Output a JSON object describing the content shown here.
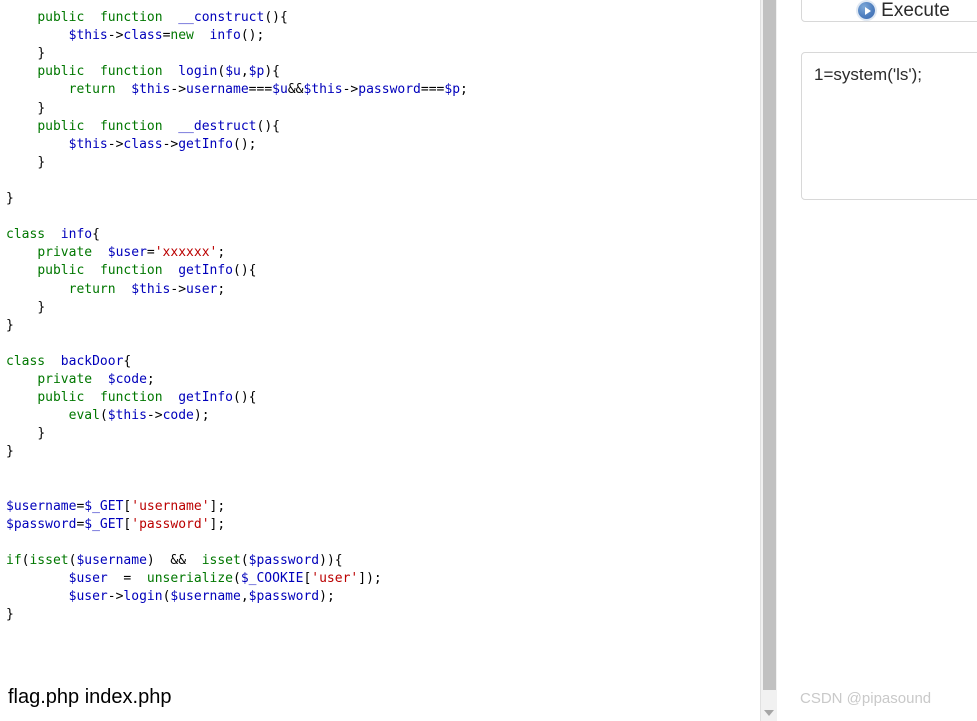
{
  "code_pane": {
    "language": "php",
    "lines": [
      {
        "indent": 0,
        "tokens": []
      },
      {
        "indent": 4,
        "tokens": [
          {
            "t": "public",
            "c": "kw"
          },
          {
            "t": "  ",
            "c": "pun"
          },
          {
            "t": "function",
            "c": "kw"
          },
          {
            "t": "  ",
            "c": "pun"
          },
          {
            "t": "__construct",
            "c": "var"
          },
          {
            "t": "(){",
            "c": "pun"
          }
        ]
      },
      {
        "indent": 8,
        "tokens": [
          {
            "t": "$this",
            "c": "var"
          },
          {
            "t": "->",
            "c": "pun"
          },
          {
            "t": "class",
            "c": "var"
          },
          {
            "t": "=",
            "c": "pun"
          },
          {
            "t": "new",
            "c": "kw"
          },
          {
            "t": "  ",
            "c": "pun"
          },
          {
            "t": "info",
            "c": "var"
          },
          {
            "t": "();",
            "c": "pun"
          }
        ]
      },
      {
        "indent": 4,
        "tokens": [
          {
            "t": "}",
            "c": "pun"
          }
        ]
      },
      {
        "indent": 4,
        "tokens": [
          {
            "t": "public",
            "c": "kw"
          },
          {
            "t": "  ",
            "c": "pun"
          },
          {
            "t": "function",
            "c": "kw"
          },
          {
            "t": "  ",
            "c": "pun"
          },
          {
            "t": "login",
            "c": "var"
          },
          {
            "t": "(",
            "c": "pun"
          },
          {
            "t": "$u",
            "c": "var"
          },
          {
            "t": ",",
            "c": "pun"
          },
          {
            "t": "$p",
            "c": "var"
          },
          {
            "t": "){",
            "c": "pun"
          }
        ]
      },
      {
        "indent": 8,
        "tokens": [
          {
            "t": "return",
            "c": "kw"
          },
          {
            "t": "  ",
            "c": "pun"
          },
          {
            "t": "$this",
            "c": "var"
          },
          {
            "t": "->",
            "c": "pun"
          },
          {
            "t": "username",
            "c": "var"
          },
          {
            "t": "===",
            "c": "pun"
          },
          {
            "t": "$u",
            "c": "var"
          },
          {
            "t": "&&",
            "c": "pun"
          },
          {
            "t": "$this",
            "c": "var"
          },
          {
            "t": "->",
            "c": "pun"
          },
          {
            "t": "password",
            "c": "var"
          },
          {
            "t": "===",
            "c": "pun"
          },
          {
            "t": "$p",
            "c": "var"
          },
          {
            "t": ";",
            "c": "pun"
          }
        ]
      },
      {
        "indent": 4,
        "tokens": [
          {
            "t": "}",
            "c": "pun"
          }
        ]
      },
      {
        "indent": 4,
        "tokens": [
          {
            "t": "public",
            "c": "kw"
          },
          {
            "t": "  ",
            "c": "pun"
          },
          {
            "t": "function",
            "c": "kw"
          },
          {
            "t": "  ",
            "c": "pun"
          },
          {
            "t": "__destruct",
            "c": "var"
          },
          {
            "t": "(){",
            "c": "pun"
          }
        ]
      },
      {
        "indent": 8,
        "tokens": [
          {
            "t": "$this",
            "c": "var"
          },
          {
            "t": "->",
            "c": "pun"
          },
          {
            "t": "class",
            "c": "var"
          },
          {
            "t": "->",
            "c": "pun"
          },
          {
            "t": "getInfo",
            "c": "var"
          },
          {
            "t": "();",
            "c": "pun"
          }
        ]
      },
      {
        "indent": 4,
        "tokens": [
          {
            "t": "}",
            "c": "pun"
          }
        ]
      },
      {
        "indent": 0,
        "tokens": []
      },
      {
        "indent": 0,
        "tokens": [
          {
            "t": "}",
            "c": "pun"
          }
        ]
      },
      {
        "indent": 0,
        "tokens": []
      },
      {
        "indent": 0,
        "tokens": [
          {
            "t": "class",
            "c": "kw"
          },
          {
            "t": "  ",
            "c": "pun"
          },
          {
            "t": "info",
            "c": "var"
          },
          {
            "t": "{",
            "c": "pun"
          }
        ]
      },
      {
        "indent": 4,
        "tokens": [
          {
            "t": "private",
            "c": "kw"
          },
          {
            "t": "  ",
            "c": "pun"
          },
          {
            "t": "$user",
            "c": "var"
          },
          {
            "t": "=",
            "c": "pun"
          },
          {
            "t": "'xxxxxx'",
            "c": "str"
          },
          {
            "t": ";",
            "c": "pun"
          }
        ]
      },
      {
        "indent": 4,
        "tokens": [
          {
            "t": "public",
            "c": "kw"
          },
          {
            "t": "  ",
            "c": "pun"
          },
          {
            "t": "function",
            "c": "kw"
          },
          {
            "t": "  ",
            "c": "pun"
          },
          {
            "t": "getInfo",
            "c": "var"
          },
          {
            "t": "(){",
            "c": "pun"
          }
        ]
      },
      {
        "indent": 8,
        "tokens": [
          {
            "t": "return",
            "c": "kw"
          },
          {
            "t": "  ",
            "c": "pun"
          },
          {
            "t": "$this",
            "c": "var"
          },
          {
            "t": "->",
            "c": "pun"
          },
          {
            "t": "user",
            "c": "var"
          },
          {
            "t": ";",
            "c": "pun"
          }
        ]
      },
      {
        "indent": 4,
        "tokens": [
          {
            "t": "}",
            "c": "pun"
          }
        ]
      },
      {
        "indent": 0,
        "tokens": [
          {
            "t": "}",
            "c": "pun"
          }
        ]
      },
      {
        "indent": 0,
        "tokens": []
      },
      {
        "indent": 0,
        "tokens": [
          {
            "t": "class",
            "c": "kw"
          },
          {
            "t": "  ",
            "c": "pun"
          },
          {
            "t": "backDoor",
            "c": "var"
          },
          {
            "t": "{",
            "c": "pun"
          }
        ]
      },
      {
        "indent": 4,
        "tokens": [
          {
            "t": "private",
            "c": "kw"
          },
          {
            "t": "  ",
            "c": "pun"
          },
          {
            "t": "$code",
            "c": "var"
          },
          {
            "t": ";",
            "c": "pun"
          }
        ]
      },
      {
        "indent": 4,
        "tokens": [
          {
            "t": "public",
            "c": "kw"
          },
          {
            "t": "  ",
            "c": "pun"
          },
          {
            "t": "function",
            "c": "kw"
          },
          {
            "t": "  ",
            "c": "pun"
          },
          {
            "t": "getInfo",
            "c": "var"
          },
          {
            "t": "(){",
            "c": "pun"
          }
        ]
      },
      {
        "indent": 8,
        "tokens": [
          {
            "t": "eval",
            "c": "kw"
          },
          {
            "t": "(",
            "c": "pun"
          },
          {
            "t": "$this",
            "c": "var"
          },
          {
            "t": "->",
            "c": "pun"
          },
          {
            "t": "code",
            "c": "var"
          },
          {
            "t": ");",
            "c": "pun"
          }
        ]
      },
      {
        "indent": 4,
        "tokens": [
          {
            "t": "}",
            "c": "pun"
          }
        ]
      },
      {
        "indent": 0,
        "tokens": [
          {
            "t": "}",
            "c": "pun"
          }
        ]
      },
      {
        "indent": 0,
        "tokens": []
      },
      {
        "indent": 0,
        "tokens": []
      },
      {
        "indent": 0,
        "tokens": [
          {
            "t": "$username",
            "c": "var"
          },
          {
            "t": "=",
            "c": "pun"
          },
          {
            "t": "$_GET",
            "c": "var"
          },
          {
            "t": "[",
            "c": "pun"
          },
          {
            "t": "'username'",
            "c": "str"
          },
          {
            "t": "];",
            "c": "pun"
          }
        ]
      },
      {
        "indent": 0,
        "tokens": [
          {
            "t": "$password",
            "c": "var"
          },
          {
            "t": "=",
            "c": "pun"
          },
          {
            "t": "$_GET",
            "c": "var"
          },
          {
            "t": "[",
            "c": "pun"
          },
          {
            "t": "'password'",
            "c": "str"
          },
          {
            "t": "];",
            "c": "pun"
          }
        ]
      },
      {
        "indent": 0,
        "tokens": []
      },
      {
        "indent": 0,
        "tokens": [
          {
            "t": "if",
            "c": "kw"
          },
          {
            "t": "(",
            "c": "pun"
          },
          {
            "t": "isset",
            "c": "kw"
          },
          {
            "t": "(",
            "c": "pun"
          },
          {
            "t": "$username",
            "c": "var"
          },
          {
            "t": ")",
            "c": "pun"
          },
          {
            "t": "  ",
            "c": "pun"
          },
          {
            "t": "&&",
            "c": "pun"
          },
          {
            "t": "  ",
            "c": "pun"
          },
          {
            "t": "isset",
            "c": "kw"
          },
          {
            "t": "(",
            "c": "pun"
          },
          {
            "t": "$password",
            "c": "var"
          },
          {
            "t": ")){",
            "c": "pun"
          }
        ]
      },
      {
        "indent": 8,
        "tokens": [
          {
            "t": "$user",
            "c": "var"
          },
          {
            "t": "  ",
            "c": "pun"
          },
          {
            "t": "=",
            "c": "pun"
          },
          {
            "t": "  ",
            "c": "pun"
          },
          {
            "t": "unserialize",
            "c": "kw"
          },
          {
            "t": "(",
            "c": "pun"
          },
          {
            "t": "$_COOKIE",
            "c": "var"
          },
          {
            "t": "[",
            "c": "pun"
          },
          {
            "t": "'user'",
            "c": "str"
          },
          {
            "t": "]);",
            "c": "pun"
          }
        ]
      },
      {
        "indent": 8,
        "tokens": [
          {
            "t": "$user",
            "c": "var"
          },
          {
            "t": "->",
            "c": "pun"
          },
          {
            "t": "login",
            "c": "var"
          },
          {
            "t": "(",
            "c": "pun"
          },
          {
            "t": "$username",
            "c": "var"
          },
          {
            "t": ",",
            "c": "pun"
          },
          {
            "t": "$password",
            "c": "var"
          },
          {
            "t": ");",
            "c": "pun"
          }
        ]
      },
      {
        "indent": 0,
        "tokens": [
          {
            "t": "}",
            "c": "pun"
          }
        ]
      }
    ],
    "colors": {
      "keyword": "#007700",
      "variable": "#0000bb",
      "string": "#bb0000",
      "punctuation": "#000000",
      "background": "#ffffff"
    }
  },
  "scrollbar": {
    "down_arrow_icon": "chevron-down-icon",
    "track_color": "#f1f1f1",
    "thumb_color": "#c1c1c1"
  },
  "file_list": {
    "text": "flag.php index.php"
  },
  "right_panel": {
    "execute_button": {
      "label": "Execute",
      "icon": "play-circle-icon",
      "icon_color": "#4f7fbf"
    },
    "result_box": {
      "text": "1=system('ls');"
    }
  },
  "watermark": {
    "text": "CSDN @pipasound",
    "color": "#c9c9c9"
  }
}
